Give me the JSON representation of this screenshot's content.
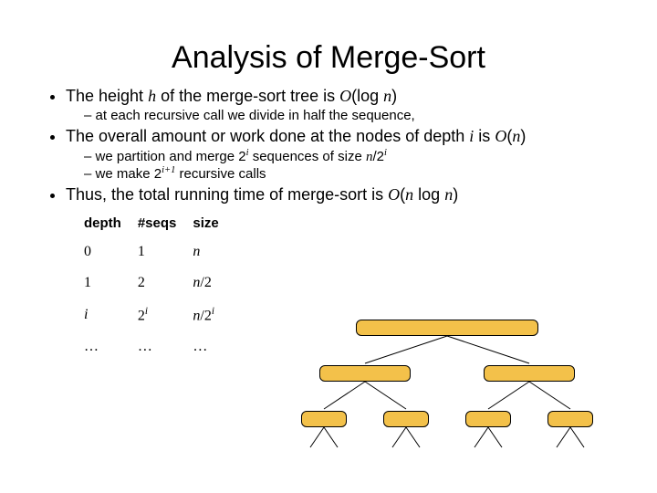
{
  "title": "Analysis of Merge-Sort",
  "bullets": {
    "b1_pre": "The height ",
    "b1_h": "h",
    "b1_mid": " of the merge-sort tree is ",
    "b1_O": "O",
    "b1_paren1": "(log ",
    "b1_n": "n",
    "b1_paren2": ")",
    "b1_sub1": "at each recursive call we divide in half the sequence,",
    "b2_pre": "The overall amount or work done at the nodes of depth ",
    "b2_i": "i",
    "b2_mid": " is ",
    "b2_O": "O",
    "b2_p1": "(",
    "b2_n": "n",
    "b2_p2": ")",
    "b2_sub1_pre": "we partition and merge ",
    "b2_sub1_2": "2",
    "b2_sub1_i": "i",
    "b2_sub1_mid": " sequences of size ",
    "b2_sub1_n": "n",
    "b2_sub1_slash": "/",
    "b2_sub1_2b": "2",
    "b2_sub1_ib": "i",
    "b2_sub2_pre": "we make ",
    "b2_sub2_2": "2",
    "b2_sub2_exp": "i+1",
    "b2_sub2_post": " recursive calls",
    "b3_pre": "Thus, the total running time of merge-sort is ",
    "b3_O": "O",
    "b3_p1": "(",
    "b3_n1": "n",
    "b3_log": " log ",
    "b3_n2": "n",
    "b3_p2": ")"
  },
  "table": {
    "headers": {
      "c1": "depth",
      "c2": "#seqs",
      "c3": "size"
    },
    "rows": [
      {
        "c1": "0",
        "c2": "1",
        "c3_n": "n",
        "c3_rest": ""
      },
      {
        "c1": "1",
        "c2": "2",
        "c3_n": "n",
        "c3_rest": "/2"
      },
      {
        "c1": "i",
        "c2_base": "2",
        "c2_sup": "i",
        "c3_n": "n",
        "c3_rest": "/2",
        "c3_sup": "i"
      },
      {
        "c1": "…",
        "c2": "…",
        "c3": "…"
      }
    ]
  }
}
